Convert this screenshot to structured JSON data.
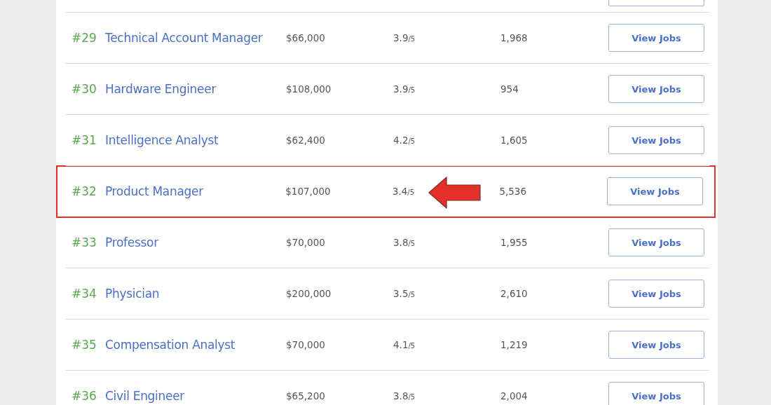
{
  "rows": [
    {
      "rank": "#29",
      "title": "Technical Account Manager",
      "salary": "$66,000",
      "rating": "3.9",
      "rating_scale": "/5",
      "count": "1,968",
      "button": "View Jobs",
      "highlighted": false,
      "arrow": false
    },
    {
      "rank": "#30",
      "title": "Hardware Engineer",
      "salary": "$108,000",
      "rating": "3.9",
      "rating_scale": "/5",
      "count": "954",
      "button": "View Jobs",
      "highlighted": false,
      "arrow": false
    },
    {
      "rank": "#31",
      "title": "Intelligence Analyst",
      "salary": "$62,400",
      "rating": "4.2",
      "rating_scale": "/5",
      "count": "1,605",
      "button": "View Jobs",
      "highlighted": false,
      "arrow": false
    },
    {
      "rank": "#32",
      "title": "Product Manager",
      "salary": "$107,000",
      "rating": "3.4",
      "rating_scale": "/5",
      "count": "5,536",
      "button": "View Jobs",
      "highlighted": true,
      "arrow": true
    },
    {
      "rank": "#33",
      "title": "Professor",
      "salary": "$70,000",
      "rating": "3.8",
      "rating_scale": "/5",
      "count": "1,955",
      "button": "View Jobs",
      "highlighted": false,
      "arrow": false
    },
    {
      "rank": "#34",
      "title": "Physician",
      "salary": "$200,000",
      "rating": "3.5",
      "rating_scale": "/5",
      "count": "2,610",
      "button": "View Jobs",
      "highlighted": false,
      "arrow": false
    },
    {
      "rank": "#35",
      "title": "Compensation Analyst",
      "salary": "$70,000",
      "rating": "4.1",
      "rating_scale": "/5",
      "count": "1,219",
      "button": "View Jobs",
      "highlighted": false,
      "arrow": false
    },
    {
      "rank": "#36",
      "title": "Civil Engineer",
      "salary": "$65,200",
      "rating": "3.8",
      "rating_scale": "/5",
      "count": "2,004",
      "button": "View Jobs",
      "highlighted": false,
      "arrow": false
    }
  ]
}
